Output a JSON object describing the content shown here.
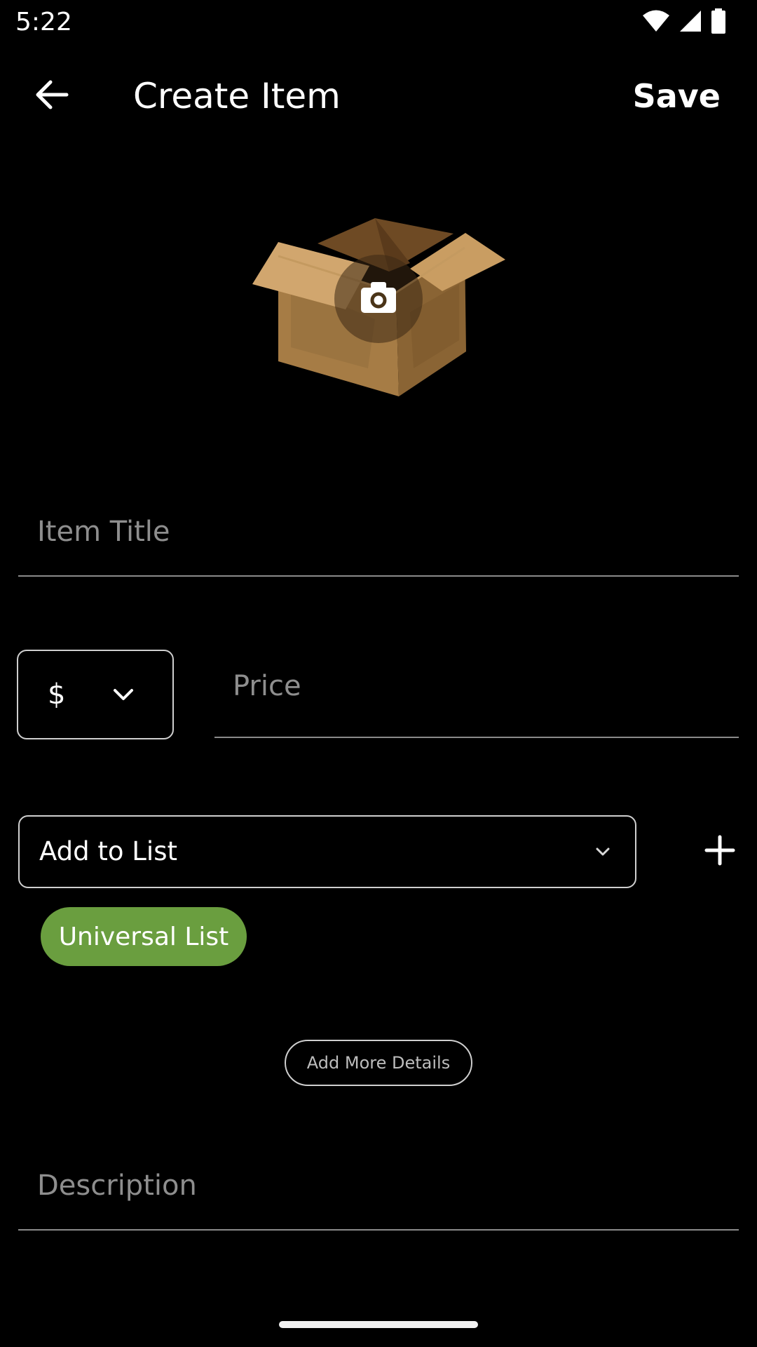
{
  "status_bar": {
    "time": "5:22",
    "icons": [
      "wifi-icon",
      "cellular-signal-icon",
      "battery-icon"
    ]
  },
  "app_bar": {
    "back_icon": "arrow-back-icon",
    "title": "Create Item",
    "save_label": "Save"
  },
  "image_picker": {
    "image": "open-cardboard-box",
    "overlay_icon": "camera-icon"
  },
  "form": {
    "title_placeholder": "Item Title",
    "currency": {
      "value": "$",
      "icon": "chevron-down-icon"
    },
    "price_placeholder": "Price",
    "list_select": {
      "label": "Add to List",
      "icon": "chevron-down-icon"
    },
    "add_list_icon": "plus-icon",
    "selected_lists": [
      "Universal List"
    ],
    "more_details_label": "Add More Details",
    "description_placeholder": "Description"
  },
  "colors": {
    "background": "#000000",
    "chip": "#6a9e3f",
    "text": "#ffffff",
    "placeholder": "#8e8e8e",
    "field_line": "#8a8a8a"
  }
}
